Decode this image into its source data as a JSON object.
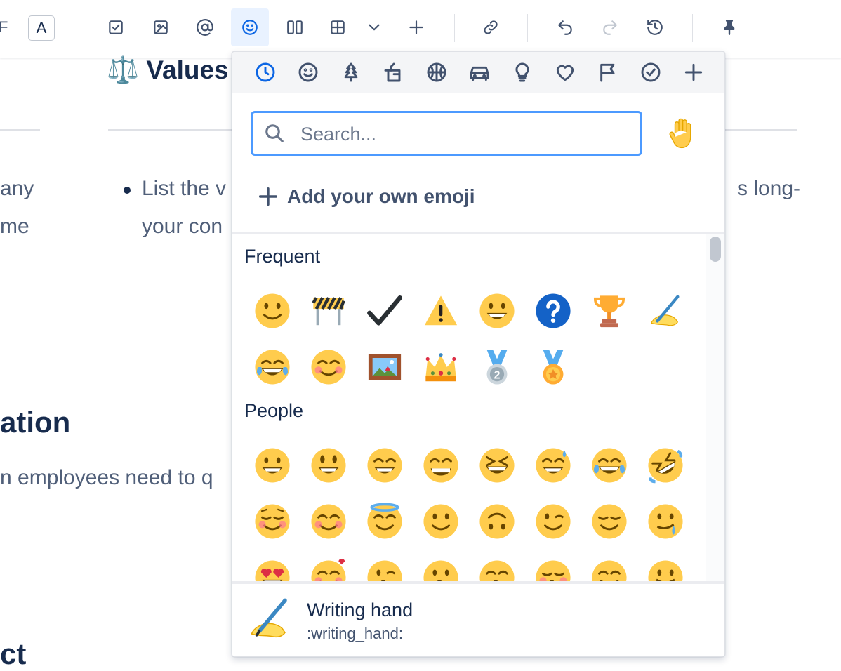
{
  "toolbar": {
    "cutoff_glyph": "F",
    "text_color_label": "A"
  },
  "content": {
    "heading_emoji": "⚖️",
    "heading_text": "Values",
    "left_text_1": "any",
    "left_text_2": "me",
    "bullet_text_1a": "List the v",
    "bullet_text_1b": "s long-",
    "bullet_text_2": "your con",
    "section_heading_1": "ation",
    "body_text_2": "n employees need to q",
    "section_heading_2": "ct"
  },
  "picker": {
    "search_placeholder": "Search...",
    "tone_emoji": "✋",
    "add_own_label": "Add your own emoji",
    "categories": [
      {
        "icon": "clock-icon",
        "label": "Frequent"
      },
      {
        "icon": "smiley-icon",
        "label": "People"
      },
      {
        "icon": "tree-icon",
        "label": "Nature"
      },
      {
        "icon": "food-icon",
        "label": "Food"
      },
      {
        "icon": "basketball-icon",
        "label": "Activity"
      },
      {
        "icon": "car-icon",
        "label": "Travel"
      },
      {
        "icon": "lightbulb-icon",
        "label": "Objects"
      },
      {
        "icon": "heart-icon",
        "label": "Symbols"
      },
      {
        "icon": "flag-icon",
        "label": "Flags"
      },
      {
        "icon": "checkmark-icon",
        "label": "Productivity"
      },
      {
        "icon": "plus-icon",
        "label": "Custom"
      }
    ],
    "section_frequent_label": "Frequent",
    "section_people_label": "People",
    "frequent": [
      "slight-smile",
      "construction",
      "check-mark",
      "warning",
      "grinning",
      "question",
      "trophy",
      "writing-hand",
      "joy",
      "blush",
      "framed-picture",
      "crown",
      "second-place-medal",
      "sports-medal"
    ],
    "people": [
      "grinning",
      "smiley",
      "smile",
      "grin",
      "laughing",
      "sweat-smile",
      "joy",
      "rofl",
      "relaxed",
      "blush",
      "innocent",
      "slight-smile",
      "upside-down",
      "wink",
      "relieved",
      "yum-drool",
      "heart-eyes",
      "smiling-hearts",
      "kissing-heart",
      "kissing",
      "kissing-smiling",
      "kissing-closed",
      "yum",
      "tongue"
    ],
    "preview": {
      "name": "Writing hand",
      "shortname": ":writing_hand:"
    }
  },
  "colors": {
    "accent": "#0c66e4",
    "focus_ring": "#4c9aff",
    "active_bg": "#e9f2ff",
    "emoji_yellow": "#ffcc4d"
  }
}
